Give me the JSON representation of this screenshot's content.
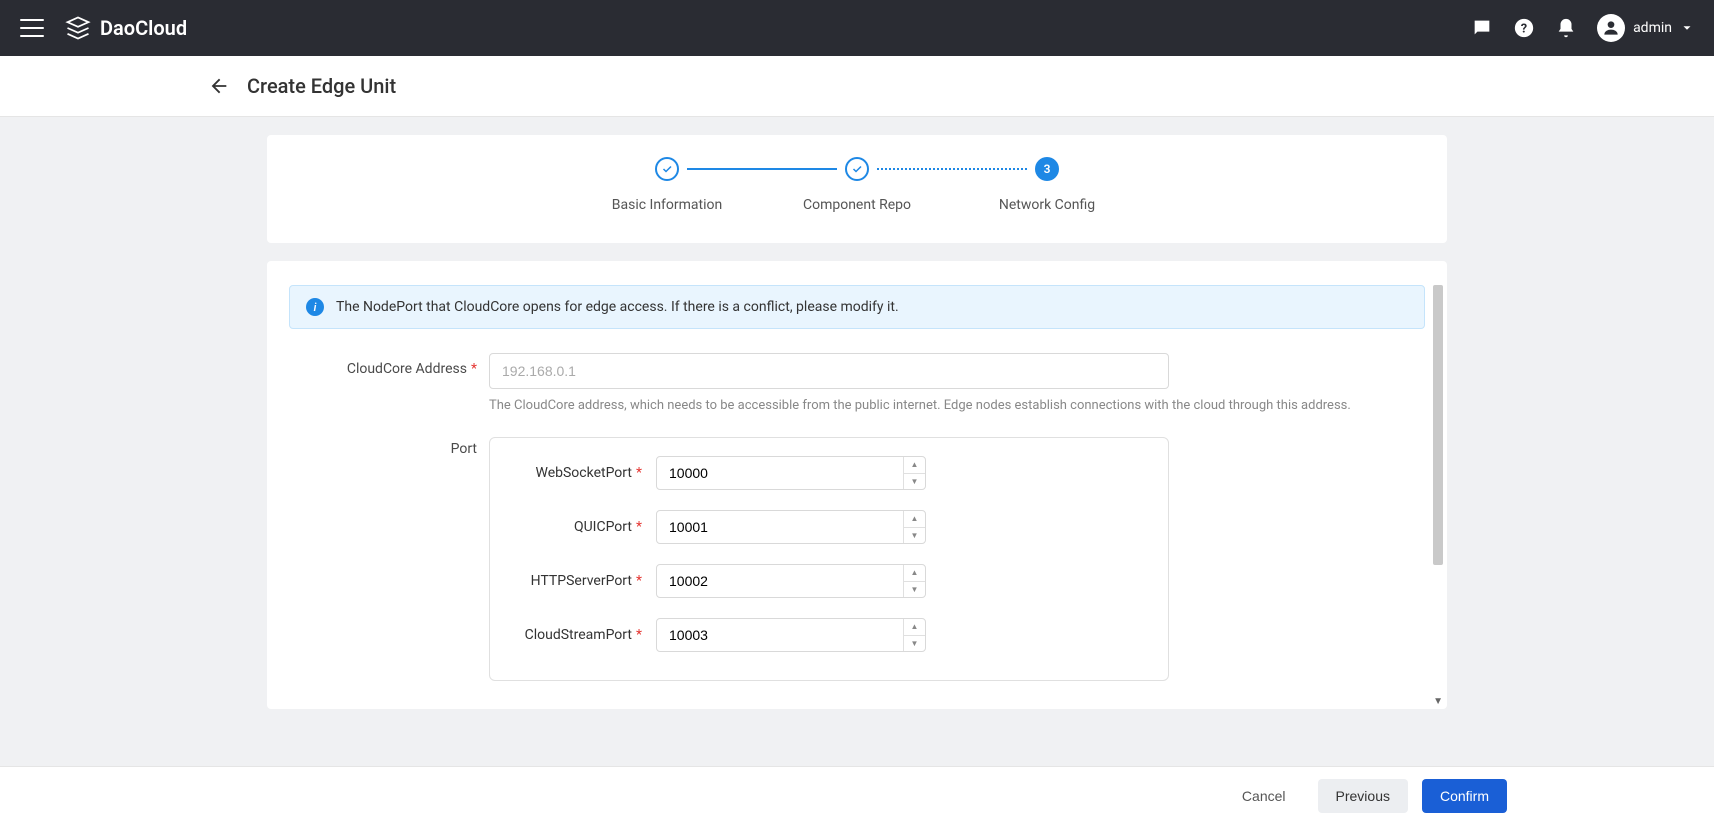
{
  "topbar": {
    "brand": "DaoCloud",
    "user_name": "admin"
  },
  "page": {
    "title": "Create Edge Unit"
  },
  "stepper": {
    "steps": [
      {
        "label": "Basic Information",
        "state": "done"
      },
      {
        "label": "Component Repo",
        "state": "done"
      },
      {
        "label": "Network Config",
        "state": "current",
        "number": "3"
      }
    ]
  },
  "banner": {
    "text": "The NodePort that CloudCore opens for edge access. If there is a conflict, please modify it."
  },
  "form": {
    "cloudcore_address": {
      "label": "CloudCore Address",
      "placeholder": "192.168.0.1",
      "help": "The CloudCore address, which needs to be accessible from the public internet. Edge nodes establish connections with the cloud through this address."
    },
    "port_section_label": "Port",
    "ports": {
      "websocket": {
        "label": "WebSocketPort",
        "value": "10000"
      },
      "quic": {
        "label": "QUICPort",
        "value": "10001"
      },
      "httpserver": {
        "label": "HTTPServerPort",
        "value": "10002"
      },
      "cloudstream": {
        "label": "CloudStreamPort",
        "value": "10003"
      }
    }
  },
  "footer": {
    "cancel": "Cancel",
    "previous": "Previous",
    "confirm": "Confirm"
  }
}
